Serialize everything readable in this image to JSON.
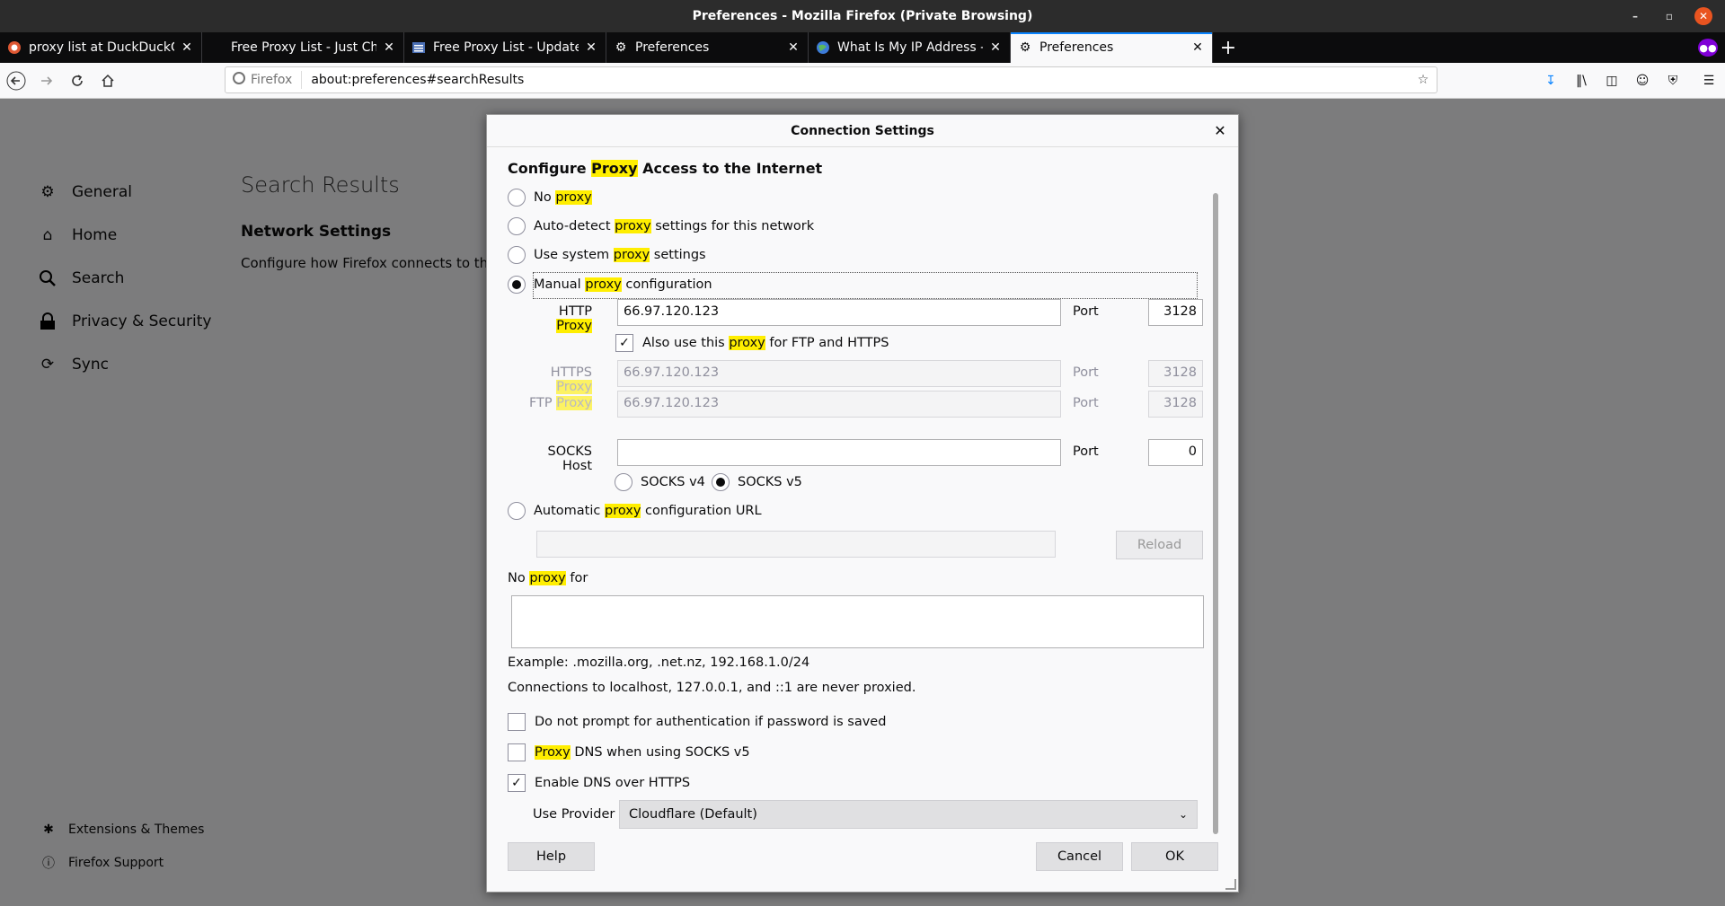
{
  "window": {
    "title": "Preferences - Mozilla Firefox (Private Browsing)"
  },
  "tabs": [
    {
      "label": "proxy list at DuckDuckGo",
      "icon": "duckduckgo-icon",
      "active": false
    },
    {
      "label": "Free Proxy List - Just Che",
      "icon": "blank-page-icon",
      "active": false
    },
    {
      "label": "Free Proxy List - Update",
      "icon": "list-page-icon",
      "active": false
    },
    {
      "label": "Preferences",
      "icon": "gear-icon",
      "active": false
    },
    {
      "label": "What Is My IP Address - S",
      "icon": "globe-icon",
      "active": false
    },
    {
      "label": "Preferences",
      "icon": "gear-icon",
      "active": true
    }
  ],
  "navbar": {
    "identity_label": "Firefox",
    "url": "about:preferences#searchResults"
  },
  "sidebar": {
    "items": [
      {
        "label": "General",
        "icon": "gear-icon"
      },
      {
        "label": "Home",
        "icon": "home-icon"
      },
      {
        "label": "Search",
        "icon": "search-icon"
      },
      {
        "label": "Privacy & Security",
        "icon": "lock-icon"
      },
      {
        "label": "Sync",
        "icon": "sync-icon"
      }
    ],
    "bottom": [
      {
        "label": "Extensions & Themes",
        "icon": "puzzle-icon"
      },
      {
        "label": "Firefox Support",
        "icon": "help-icon"
      }
    ]
  },
  "page": {
    "title": "Search Results",
    "section_title": "Network Settings",
    "section_desc": "Configure how Firefox connects to the internet."
  },
  "dialog": {
    "title": "Connection Settings",
    "heading_pre": "Configure ",
    "heading_hl": "Proxy",
    "heading_post": " Access to the Internet",
    "proxy_word": "proxy",
    "proxy_word_cap": "Proxy",
    "options": {
      "no_proxy_pre": "No ",
      "auto_detect_pre": "Auto-detect ",
      "auto_detect_post": " settings for this network",
      "system_pre": "Use system ",
      "system_post": " settings",
      "manual_pre": "Manual ",
      "manual_post": " configuration",
      "auto_url_pre": "Automatic ",
      "auto_url_post": " configuration URL"
    },
    "selected_option": "manual",
    "http_label_pre": "HTTP ",
    "http_proxy": "66.97.120.123",
    "http_port": "3128",
    "port_label": "Port",
    "also_use_pre": "Also use this ",
    "also_use_post": " for FTP and HTTPS",
    "also_use_checked": true,
    "https_label_pre": "HTTPS ",
    "https_proxy": "66.97.120.123",
    "https_port": "3128",
    "ftp_label_pre": "FTP ",
    "ftp_proxy": "66.97.120.123",
    "ftp_port": "3128",
    "socks_label": "SOCKS Host",
    "socks_host": "",
    "socks_port": "0",
    "socks_v4": "SOCKS v4",
    "socks_v5": "SOCKS v5",
    "socks_selected": "v5",
    "reload_label": "Reload",
    "no_proxy_for_pre": "No ",
    "no_proxy_for_post": " for",
    "no_proxy_value": "",
    "example_text": "Example: .mozilla.org, .net.nz, 192.168.1.0/24",
    "localhost_text": "Connections to localhost, 127.0.0.1, and ::1 are never proxied.",
    "no_prompt_label": "Do not prompt for authentication if password is saved",
    "no_prompt_checked": false,
    "proxy_dns_post": " DNS when using SOCKS v5",
    "proxy_dns_checked": false,
    "doh_label": "Enable DNS over HTTPS",
    "doh_checked": true,
    "provider_label": "Use Provider",
    "provider_value": "Cloudflare (Default)",
    "help_label": "Help",
    "cancel_label": "Cancel",
    "ok_label": "OK"
  }
}
